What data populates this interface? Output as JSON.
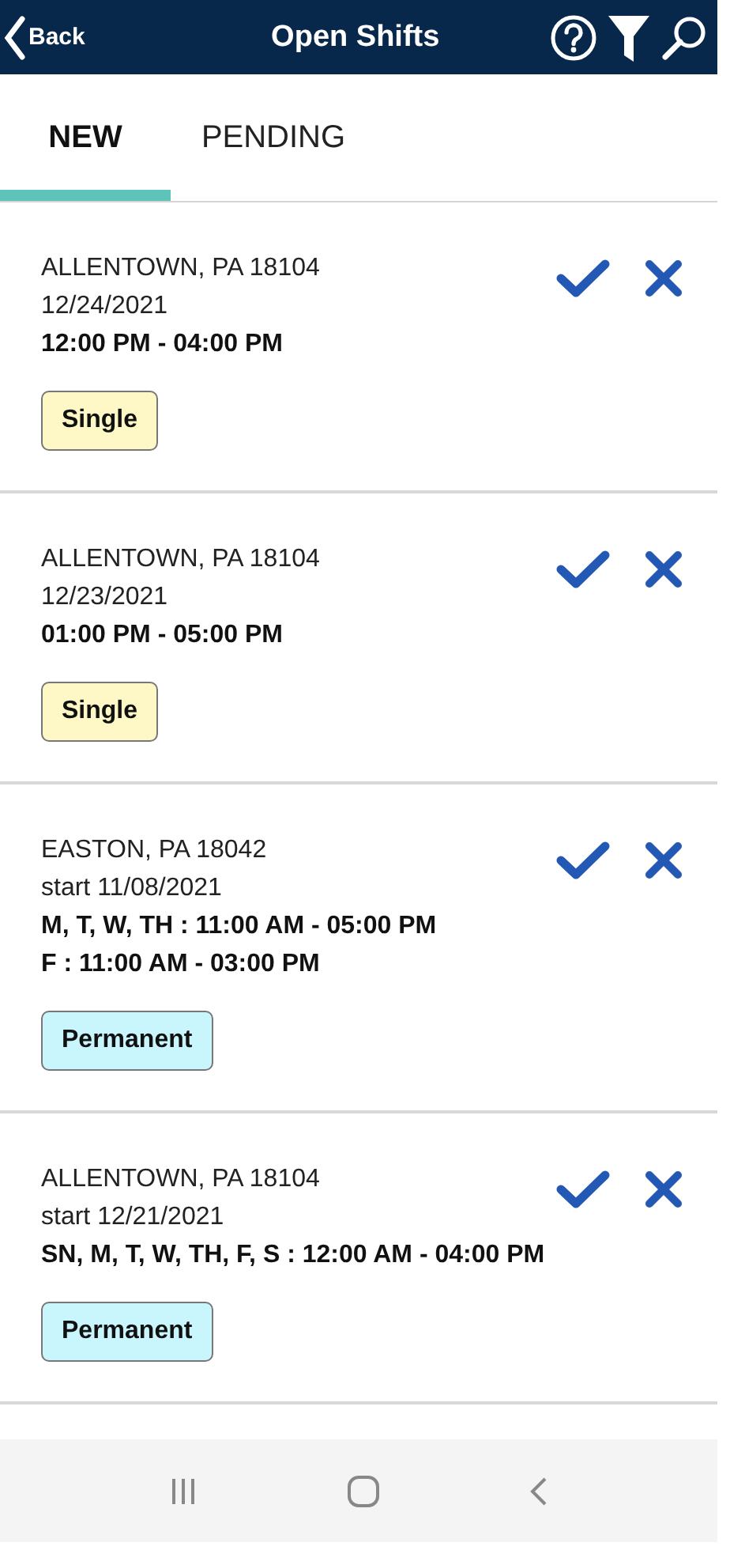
{
  "header": {
    "back": "Back",
    "title": "Open Shifts"
  },
  "tabs": [
    {
      "label": "NEW",
      "selected": true
    },
    {
      "label": "PENDING",
      "selected": false
    }
  ],
  "shifts": [
    {
      "location": "ALLENTOWN, PA 18104",
      "date": "12/24/2021",
      "schedule": [
        "12:00 PM - 04:00 PM"
      ],
      "tag": {
        "label": "Single",
        "kind": "single"
      }
    },
    {
      "location": "ALLENTOWN, PA 18104",
      "date": "12/23/2021",
      "schedule": [
        "01:00 PM - 05:00 PM"
      ],
      "tag": {
        "label": "Single",
        "kind": "single"
      }
    },
    {
      "location": "EASTON, PA 18042",
      "date": "start 11/08/2021",
      "schedule": [
        "M, T, W, TH : 11:00 AM - 05:00 PM",
        "F : 11:00 AM - 03:00 PM"
      ],
      "tag": {
        "label": "Permanent",
        "kind": "permanent"
      }
    },
    {
      "location": "ALLENTOWN, PA 18104",
      "date": "start 12/21/2021",
      "schedule": [
        "SN, M, T, W, TH, F, S : 12:00 AM - 04:00 PM"
      ],
      "tag": {
        "label": "Permanent",
        "kind": "permanent"
      }
    }
  ]
}
